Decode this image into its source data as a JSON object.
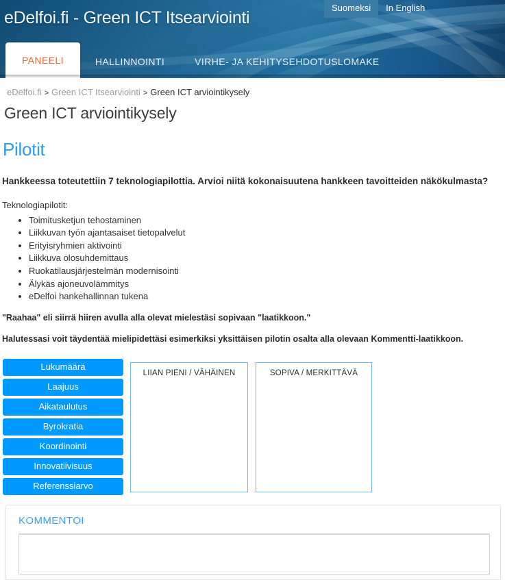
{
  "header": {
    "site_title": "eDelfoi.fi - Green ICT Itsearviointi",
    "languages": [
      {
        "label": "Suomeksi",
        "active": true
      },
      {
        "label": "In English",
        "active": false
      }
    ],
    "nav": [
      {
        "label": "PANEELI",
        "active": true
      },
      {
        "label": "HALLINNOINTI",
        "active": false
      },
      {
        "label": "VIRHE- JA KEHITYSEHDOTUSLOMAKE",
        "active": false
      }
    ],
    "accent_color": "#e8663c",
    "background_color": "#14527e"
  },
  "breadcrumb": {
    "items": [
      {
        "label": "eDelfoi.fi",
        "current": false
      },
      {
        "label": "Green ICT Itsearviointi",
        "current": false
      },
      {
        "label": "Green ICT arviointikysely",
        "current": true
      }
    ],
    "separator": ">"
  },
  "page": {
    "title": "Green ICT arviointikysely",
    "section_title": "Pilotit",
    "section_title_color": "#2f9bf5",
    "question": "Hankkeessa toteutettiin 7 teknologiapilottia. Arvioi niitä kokonaisuutena hankkeen tavoitteiden näkökulmasta?",
    "intro": "Teknologiapilotit:",
    "pilots": [
      "Toimitusketjun tehostaminen",
      "Liikkuvan työn ajantasaiset tietopalvelut",
      "Erityisryhmien aktivointi",
      "Liikkuva olosuhdemittaus",
      "Ruokatilausjärjestelmän modernisointi",
      "Älykäs ajoneuvolämmitys",
      "eDelfoi hankehallinnan tukena"
    ],
    "note_1": "\"Raahaa\" eli siirrä hiiren avulla alla olevat mielestäsi sopivaan \"laatikkoon.\"",
    "note_2": "Halutessasi voit täydentää mielipidettäsi esimerkiksi yksittäisen pilotin osalta alla olevaan Kommentti-laatikkoon."
  },
  "drag": {
    "item_color": "#0099ff",
    "items": [
      "Lukumäärä",
      "Laajuus",
      "Aikataulutus",
      "Byrokratia",
      "Koordinointi",
      "Innovatiivisuus",
      "Referenssiarvo"
    ],
    "dropzones": [
      {
        "label": "LIIAN PIENI / VÄHÄINEN",
        "items": []
      },
      {
        "label": "SOPIVA / MERKITTÄVÄ",
        "items": []
      }
    ],
    "dropzone_border_color": "#6cb8f0"
  },
  "comment": {
    "title": "KOMMENTOI",
    "title_color": "#3aa0f3",
    "textarea_value": "",
    "textarea_placeholder": ""
  }
}
